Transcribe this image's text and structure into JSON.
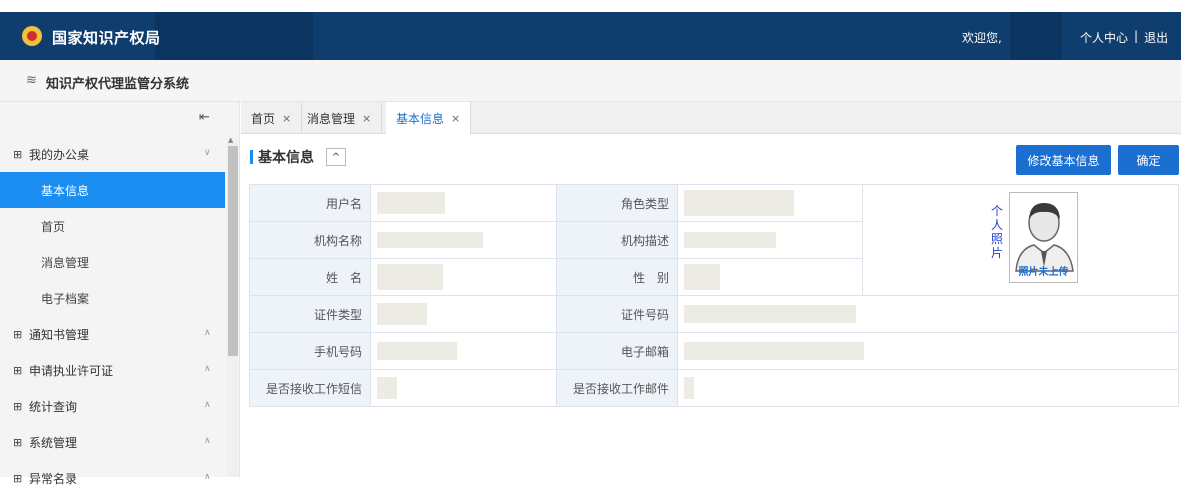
{
  "header": {
    "org_name": "国家知识产权局",
    "welcome": "欢迎您,",
    "personal_center": "个人中心",
    "separator": "|",
    "logout": "退出"
  },
  "subheader": {
    "layers_icon": "≋",
    "system_name": "知识产权代理监管分系统"
  },
  "sidebar": {
    "collapse_icon": "⇤",
    "groups": [
      {
        "label": "我的办公桌",
        "expanded": true
      },
      {
        "label": "通知书管理",
        "expanded": false
      },
      {
        "label": "申请执业许可证",
        "expanded": false
      },
      {
        "label": "统计查询",
        "expanded": false
      },
      {
        "label": "系统管理",
        "expanded": false
      },
      {
        "label": "异常名录",
        "expanded": false
      }
    ],
    "items": [
      "基本信息",
      "首页",
      "消息管理",
      "电子档案"
    ]
  },
  "tabs": [
    {
      "label": "首页",
      "active": false
    },
    {
      "label": "消息管理",
      "active": false
    },
    {
      "label": "基本信息",
      "active": true
    }
  ],
  "section": {
    "title": "基本信息",
    "toggle": "^",
    "edit_button": "修改基本信息",
    "ok_button": "确定"
  },
  "form": {
    "username_label": "用户名",
    "role_type_label": "角色类型",
    "org_name_label": "机构名称",
    "org_desc_label": "机构描述",
    "name_label": "姓　名",
    "gender_label": "性　别",
    "id_type_label": "证件类型",
    "id_number_label": "证件号码",
    "phone_label": "手机号码",
    "email_label": "电子邮箱",
    "sms_label": "是否接收工作短信",
    "mail_label": "是否接收工作邮件",
    "photo_label": "个人照片",
    "photo_caption": "照片未上传"
  },
  "colors": {
    "header_bg": "#0f3e6e",
    "accent": "#1a8ef0",
    "button": "#1a6fd0"
  }
}
